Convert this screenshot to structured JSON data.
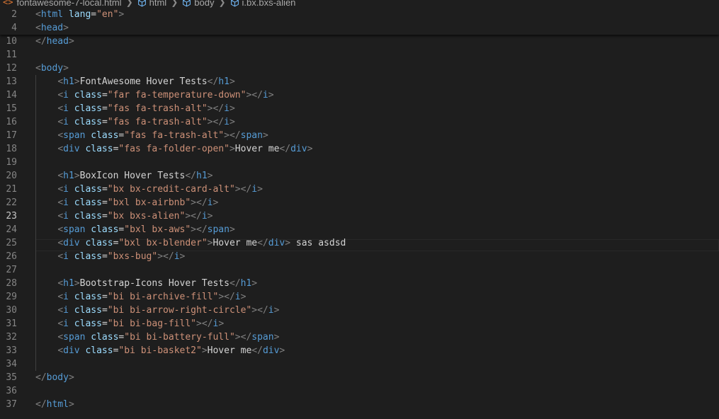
{
  "breadcrumb": [
    {
      "label": "fontawesome-7-local.html",
      "icon": "html-file-icon"
    },
    {
      "label": "html",
      "icon": "cube-icon"
    },
    {
      "label": "body",
      "icon": "cube-icon"
    },
    {
      "label": "i.bx.bxs-alien",
      "icon": "cube-icon"
    }
  ],
  "colors": {
    "background": "#1e1e1e",
    "tag": "#569cd6",
    "bracket": "#808080",
    "attribute": "#9cdcfe",
    "string": "#ce9178",
    "text": "#d4d4d4",
    "line_number": "#858585",
    "active_line_number": "#c6c6c6"
  },
  "active_line": 23,
  "sticky_lines": [
    {
      "n": 2,
      "tokens": [
        [
          "br",
          "<"
        ],
        [
          "tag",
          "html"
        ],
        [
          "txt",
          " "
        ],
        [
          "attr",
          "lang"
        ],
        [
          "txt",
          "="
        ],
        [
          "str",
          "\"en\""
        ],
        [
          "br",
          ">"
        ]
      ]
    },
    {
      "n": 4,
      "tokens": [
        [
          "br",
          "<"
        ],
        [
          "tag",
          "head"
        ],
        [
          "br",
          ">"
        ]
      ]
    }
  ],
  "lines": [
    {
      "n": 10,
      "tokens": [
        [
          "br",
          "</"
        ],
        [
          "tag",
          "head"
        ],
        [
          "br",
          ">"
        ]
      ]
    },
    {
      "n": 11,
      "tokens": []
    },
    {
      "n": 12,
      "tokens": [
        [
          "br",
          "<"
        ],
        [
          "tag",
          "body"
        ],
        [
          "br",
          ">"
        ]
      ]
    },
    {
      "n": 13,
      "tokens": [
        [
          "txt",
          "    "
        ],
        [
          "br",
          "<"
        ],
        [
          "tag",
          "h1"
        ],
        [
          "br",
          ">"
        ],
        [
          "txt",
          "FontAwesome Hover Tests"
        ],
        [
          "br",
          "</"
        ],
        [
          "tag",
          "h1"
        ],
        [
          "br",
          ">"
        ]
      ]
    },
    {
      "n": 14,
      "tokens": [
        [
          "txt",
          "    "
        ],
        [
          "br",
          "<"
        ],
        [
          "tag",
          "i"
        ],
        [
          "txt",
          " "
        ],
        [
          "attr",
          "class"
        ],
        [
          "txt",
          "="
        ],
        [
          "str",
          "\"far fa-temperature-down\""
        ],
        [
          "br",
          ">"
        ],
        [
          "br",
          "</"
        ],
        [
          "tag",
          "i"
        ],
        [
          "br",
          ">"
        ]
      ]
    },
    {
      "n": 15,
      "tokens": [
        [
          "txt",
          "    "
        ],
        [
          "br",
          "<"
        ],
        [
          "tag",
          "i"
        ],
        [
          "txt",
          " "
        ],
        [
          "attr",
          "class"
        ],
        [
          "txt",
          "="
        ],
        [
          "str",
          "\"fas fa-trash-alt\""
        ],
        [
          "br",
          ">"
        ],
        [
          "br",
          "</"
        ],
        [
          "tag",
          "i"
        ],
        [
          "br",
          ">"
        ]
      ]
    },
    {
      "n": 16,
      "tokens": [
        [
          "txt",
          "    "
        ],
        [
          "br",
          "<"
        ],
        [
          "tag",
          "i"
        ],
        [
          "txt",
          " "
        ],
        [
          "attr",
          "class"
        ],
        [
          "txt",
          "="
        ],
        [
          "str",
          "\"fas fa-trash-alt\""
        ],
        [
          "br",
          ">"
        ],
        [
          "br",
          "</"
        ],
        [
          "tag",
          "i"
        ],
        [
          "br",
          ">"
        ]
      ]
    },
    {
      "n": 17,
      "tokens": [
        [
          "txt",
          "    "
        ],
        [
          "br",
          "<"
        ],
        [
          "tag",
          "span"
        ],
        [
          "txt",
          " "
        ],
        [
          "attr",
          "class"
        ],
        [
          "txt",
          "="
        ],
        [
          "str",
          "\"fas fa-trash-alt\""
        ],
        [
          "br",
          ">"
        ],
        [
          "br",
          "</"
        ],
        [
          "tag",
          "span"
        ],
        [
          "br",
          ">"
        ]
      ]
    },
    {
      "n": 18,
      "tokens": [
        [
          "txt",
          "    "
        ],
        [
          "br",
          "<"
        ],
        [
          "tag",
          "div"
        ],
        [
          "txt",
          " "
        ],
        [
          "attr",
          "class"
        ],
        [
          "txt",
          "="
        ],
        [
          "str",
          "\"fas fa-folder-open\""
        ],
        [
          "br",
          ">"
        ],
        [
          "txt",
          "Hover me"
        ],
        [
          "br",
          "</"
        ],
        [
          "tag",
          "div"
        ],
        [
          "br",
          ">"
        ]
      ]
    },
    {
      "n": 19,
      "tokens": []
    },
    {
      "n": 20,
      "tokens": [
        [
          "txt",
          "    "
        ],
        [
          "br",
          "<"
        ],
        [
          "tag",
          "h1"
        ],
        [
          "br",
          ">"
        ],
        [
          "txt",
          "BoxIcon Hover Tests"
        ],
        [
          "br",
          "</"
        ],
        [
          "tag",
          "h1"
        ],
        [
          "br",
          ">"
        ]
      ]
    },
    {
      "n": 21,
      "tokens": [
        [
          "txt",
          "    "
        ],
        [
          "br",
          "<"
        ],
        [
          "tag",
          "i"
        ],
        [
          "txt",
          " "
        ],
        [
          "attr",
          "class"
        ],
        [
          "txt",
          "="
        ],
        [
          "str",
          "\"bx bx-credit-card-alt\""
        ],
        [
          "br",
          ">"
        ],
        [
          "br",
          "</"
        ],
        [
          "tag",
          "i"
        ],
        [
          "br",
          ">"
        ]
      ]
    },
    {
      "n": 22,
      "tokens": [
        [
          "txt",
          "    "
        ],
        [
          "br",
          "<"
        ],
        [
          "tag",
          "i"
        ],
        [
          "txt",
          " "
        ],
        [
          "attr",
          "class"
        ],
        [
          "txt",
          "="
        ],
        [
          "str",
          "\"bxl bx-airbnb\""
        ],
        [
          "br",
          ">"
        ],
        [
          "br",
          "</"
        ],
        [
          "tag",
          "i"
        ],
        [
          "br",
          ">"
        ]
      ]
    },
    {
      "n": 23,
      "tokens": [
        [
          "txt",
          "    "
        ],
        [
          "br",
          "<"
        ],
        [
          "tag",
          "i"
        ],
        [
          "txt",
          " "
        ],
        [
          "attr",
          "class"
        ],
        [
          "txt",
          "="
        ],
        [
          "str",
          "\"bx bxs-alien\""
        ],
        [
          "br",
          ">"
        ],
        [
          "br",
          "</"
        ],
        [
          "tag",
          "i"
        ],
        [
          "br",
          ">"
        ]
      ]
    },
    {
      "n": 24,
      "tokens": [
        [
          "txt",
          "    "
        ],
        [
          "br",
          "<"
        ],
        [
          "tag",
          "span"
        ],
        [
          "txt",
          " "
        ],
        [
          "attr",
          "class"
        ],
        [
          "txt",
          "="
        ],
        [
          "str",
          "\"bxl bx-aws\""
        ],
        [
          "br",
          ">"
        ],
        [
          "br",
          "</"
        ],
        [
          "tag",
          "span"
        ],
        [
          "br",
          ">"
        ]
      ]
    },
    {
      "n": 25,
      "tokens": [
        [
          "txt",
          "    "
        ],
        [
          "br",
          "<"
        ],
        [
          "tag",
          "div"
        ],
        [
          "txt",
          " "
        ],
        [
          "attr",
          "class"
        ],
        [
          "txt",
          "="
        ],
        [
          "str",
          "\"bxl bx-blender\""
        ],
        [
          "br",
          ">"
        ],
        [
          "txt",
          "Hover me"
        ],
        [
          "br",
          "</"
        ],
        [
          "tag",
          "div"
        ],
        [
          "br",
          ">"
        ],
        [
          "txt",
          " sas asdsd"
        ]
      ]
    },
    {
      "n": 26,
      "tokens": [
        [
          "txt",
          "    "
        ],
        [
          "br",
          "<"
        ],
        [
          "tag",
          "i"
        ],
        [
          "txt",
          " "
        ],
        [
          "attr",
          "class"
        ],
        [
          "txt",
          "="
        ],
        [
          "str",
          "\"bxs-bug\""
        ],
        [
          "br",
          ">"
        ],
        [
          "br",
          "</"
        ],
        [
          "tag",
          "i"
        ],
        [
          "br",
          ">"
        ]
      ]
    },
    {
      "n": 27,
      "tokens": []
    },
    {
      "n": 28,
      "tokens": [
        [
          "txt",
          "    "
        ],
        [
          "br",
          "<"
        ],
        [
          "tag",
          "h1"
        ],
        [
          "br",
          ">"
        ],
        [
          "txt",
          "Bootstrap-Icons Hover Tests"
        ],
        [
          "br",
          "</"
        ],
        [
          "tag",
          "h1"
        ],
        [
          "br",
          ">"
        ]
      ]
    },
    {
      "n": 29,
      "tokens": [
        [
          "txt",
          "    "
        ],
        [
          "br",
          "<"
        ],
        [
          "tag",
          "i"
        ],
        [
          "txt",
          " "
        ],
        [
          "attr",
          "class"
        ],
        [
          "txt",
          "="
        ],
        [
          "str",
          "\"bi bi-archive-fill\""
        ],
        [
          "br",
          ">"
        ],
        [
          "br",
          "</"
        ],
        [
          "tag",
          "i"
        ],
        [
          "br",
          ">"
        ]
      ]
    },
    {
      "n": 30,
      "tokens": [
        [
          "txt",
          "    "
        ],
        [
          "br",
          "<"
        ],
        [
          "tag",
          "i"
        ],
        [
          "txt",
          " "
        ],
        [
          "attr",
          "class"
        ],
        [
          "txt",
          "="
        ],
        [
          "str",
          "\"bi bi-arrow-right-circle\""
        ],
        [
          "br",
          ">"
        ],
        [
          "br",
          "</"
        ],
        [
          "tag",
          "i"
        ],
        [
          "br",
          ">"
        ]
      ]
    },
    {
      "n": 31,
      "tokens": [
        [
          "txt",
          "    "
        ],
        [
          "br",
          "<"
        ],
        [
          "tag",
          "i"
        ],
        [
          "txt",
          " "
        ],
        [
          "attr",
          "class"
        ],
        [
          "txt",
          "="
        ],
        [
          "str",
          "\"bi bi-bag-fill\""
        ],
        [
          "br",
          ">"
        ],
        [
          "br",
          "</"
        ],
        [
          "tag",
          "i"
        ],
        [
          "br",
          ">"
        ]
      ]
    },
    {
      "n": 32,
      "tokens": [
        [
          "txt",
          "    "
        ],
        [
          "br",
          "<"
        ],
        [
          "tag",
          "span"
        ],
        [
          "txt",
          " "
        ],
        [
          "attr",
          "class"
        ],
        [
          "txt",
          "="
        ],
        [
          "str",
          "\"bi bi-battery-full\""
        ],
        [
          "br",
          ">"
        ],
        [
          "br",
          "</"
        ],
        [
          "tag",
          "span"
        ],
        [
          "br",
          ">"
        ]
      ]
    },
    {
      "n": 33,
      "tokens": [
        [
          "txt",
          "    "
        ],
        [
          "br",
          "<"
        ],
        [
          "tag",
          "div"
        ],
        [
          "txt",
          " "
        ],
        [
          "attr",
          "class"
        ],
        [
          "txt",
          "="
        ],
        [
          "str",
          "\"bi bi-basket2\""
        ],
        [
          "br",
          ">"
        ],
        [
          "txt",
          "Hover me"
        ],
        [
          "br",
          "</"
        ],
        [
          "tag",
          "div"
        ],
        [
          "br",
          ">"
        ]
      ]
    },
    {
      "n": 34,
      "tokens": []
    },
    {
      "n": 35,
      "tokens": [
        [
          "br",
          "</"
        ],
        [
          "tag",
          "body"
        ],
        [
          "br",
          ">"
        ]
      ]
    },
    {
      "n": 36,
      "tokens": []
    },
    {
      "n": 37,
      "tokens": [
        [
          "br",
          "</"
        ],
        [
          "tag",
          "html"
        ],
        [
          "br",
          ">"
        ]
      ]
    }
  ]
}
